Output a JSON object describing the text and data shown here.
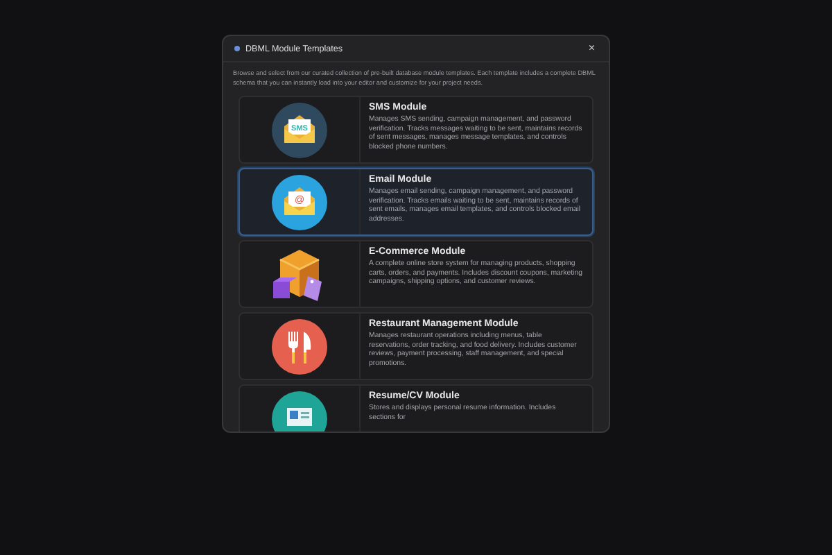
{
  "dialog": {
    "title": "DBML Module Templates",
    "close": "×",
    "description": "Browse and select from our curated collection of pre-built database module templates. Each template includes a complete DBML schema that you can instantly load into your editor and customize for your project needs."
  },
  "templates": [
    {
      "kind": "sms",
      "icon_text": "SMS",
      "title": "SMS Module",
      "description": "Manages SMS sending, campaign management, and password verification. Tracks messages waiting to be sent, maintains records of sent messages, manages message templates, and controls blocked phone numbers.",
      "selected": false
    },
    {
      "kind": "email",
      "icon_text": "@",
      "title": "Email Module",
      "description": "Manages email sending, campaign management, and password verification. Tracks emails waiting to be sent, maintains records of sent emails, manages email templates, and controls blocked email addresses.",
      "selected": true
    },
    {
      "kind": "ecommerce",
      "title": "E-Commerce Module",
      "description": "A complete online store system for managing products, shopping carts, orders, and payments. Includes discount coupons, marketing campaigns, shipping options, and customer reviews.",
      "selected": false
    },
    {
      "kind": "restaurant",
      "title": "Restaurant Management Module",
      "description": "Manages restaurant operations including menus, table reservations, order tracking, and food delivery. Includes customer reviews, payment processing, staff management, and special promotions.",
      "selected": false
    },
    {
      "kind": "resume",
      "title": "Resume/CV Module",
      "description": "Stores and displays personal resume information. Includes sections for",
      "selected": false
    }
  ]
}
